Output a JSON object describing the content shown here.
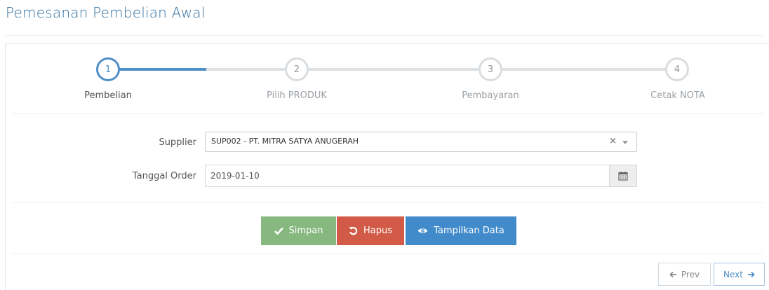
{
  "page": {
    "title": "Pemesanan Pembelian Awal"
  },
  "wizard": {
    "steps": [
      {
        "number": "1",
        "label": "Pembelian",
        "active": true
      },
      {
        "number": "2",
        "label": "Pilih PRODUK",
        "active": false
      },
      {
        "number": "3",
        "label": "Pembayaran",
        "active": false
      },
      {
        "number": "4",
        "label": "Cetak NOTA",
        "active": false
      }
    ]
  },
  "form": {
    "supplier": {
      "label": "Supplier",
      "value": "SUP002 - PT. MITRA SATYA ANUGERAH",
      "clear": "×"
    },
    "order_date": {
      "label": "Tanggal Order",
      "value": "2019-01-10"
    }
  },
  "actions": {
    "save": "Simpan",
    "delete": "Hapus",
    "show": "Tampilkan Data"
  },
  "navigation": {
    "prev": "Prev",
    "next": "Next"
  },
  "colors": {
    "accent": "#4f8fc9",
    "success": "#87b87f",
    "danger": "#d15b47",
    "primary": "#428bca"
  },
  "icons": {
    "save": "check-icon",
    "delete": "undo-icon",
    "show": "eye-icon",
    "calendar": "calendar-icon",
    "prev": "arrow-left-icon",
    "next": "arrow-right-icon"
  }
}
